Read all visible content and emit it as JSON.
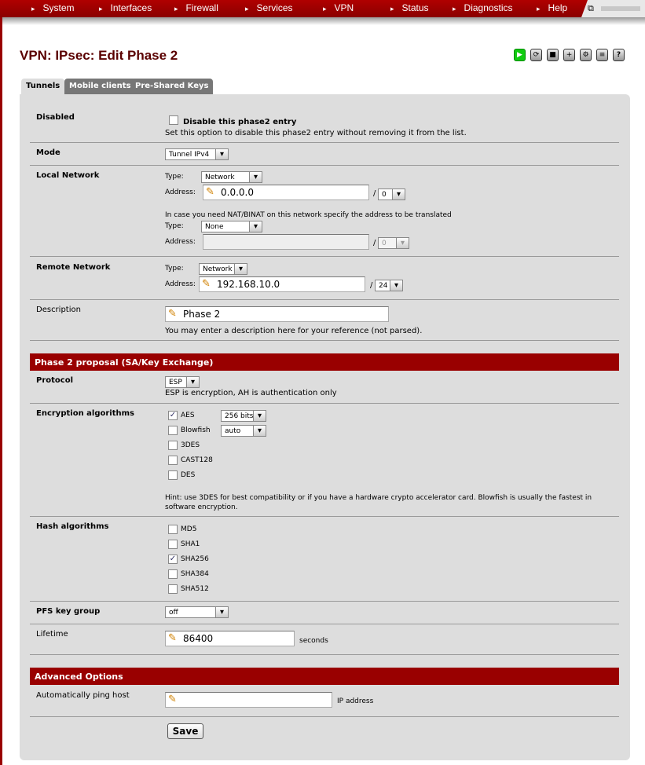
{
  "nav": [
    "System",
    "Interfaces",
    "Firewall",
    "Services",
    "VPN",
    "Status",
    "Diagnostics",
    "Help"
  ],
  "title": "VPN: IPsec: Edit Phase 2",
  "tabs": [
    "Tunnels",
    "Mobile clients",
    "Pre-Shared Keys"
  ],
  "toolbar_icons": [
    "play-icon",
    "restart-icon",
    "stop-icon",
    "add-icon",
    "settings-icon",
    "log-icon",
    "help-icon"
  ],
  "disabled": {
    "label": "Disabled",
    "checkbox": "Disable this phase2 entry",
    "checked": false,
    "hint": "Set this option to disable this phase2 entry without removing it from the list."
  },
  "mode": {
    "label": "Mode",
    "value": "Tunnel IPv4"
  },
  "local": {
    "label": "Local Network",
    "type_label": "Type:",
    "address_label": "Address:",
    "type": "Network",
    "address": "0.0.0.0",
    "mask": "0",
    "nat_hint": "In case you need NAT/BINAT on this network specify the address to be translated",
    "nat_type": "None",
    "nat_address": "",
    "nat_mask": "0"
  },
  "remote": {
    "label": "Remote Network",
    "type_label": "Type:",
    "address_label": "Address:",
    "type": "Network",
    "address": "192.168.10.0",
    "mask": "24"
  },
  "slash": "/",
  "description": {
    "label": "Description",
    "value": "Phase 2",
    "hint": "You may enter a description here for your reference (not parsed)."
  },
  "phase2_header": "Phase 2 proposal (SA/Key Exchange)",
  "protocol": {
    "label": "Protocol",
    "value": "ESP",
    "hint": "ESP is encryption, AH is authentication only"
  },
  "encryption": {
    "label": "Encryption algorithms",
    "items": [
      {
        "name": "AES",
        "checked": true,
        "option": "256 bits"
      },
      {
        "name": "Blowfish",
        "checked": false,
        "option": "auto"
      },
      {
        "name": "3DES",
        "checked": false
      },
      {
        "name": "CAST128",
        "checked": false
      },
      {
        "name": "DES",
        "checked": false
      }
    ],
    "hint": "Hint: use 3DES for best compatibility or if you have a hardware crypto accelerator card. Blowfish is usually the fastest in software encryption."
  },
  "hash": {
    "label": "Hash algorithms",
    "items": [
      {
        "name": "MD5",
        "checked": false
      },
      {
        "name": "SHA1",
        "checked": false
      },
      {
        "name": "SHA256",
        "checked": true
      },
      {
        "name": "SHA384",
        "checked": false
      },
      {
        "name": "SHA512",
        "checked": false
      }
    ]
  },
  "pfs": {
    "label": "PFS key group",
    "value": "off"
  },
  "lifetime": {
    "label": "Lifetime",
    "value": "86400",
    "unit": "seconds"
  },
  "advanced_header": "Advanced Options",
  "ping": {
    "label": "Automatically ping host",
    "value": "",
    "unit": "IP address"
  },
  "save": "Save",
  "colors": {
    "brand": "#990000",
    "panel": "#dddddd"
  }
}
